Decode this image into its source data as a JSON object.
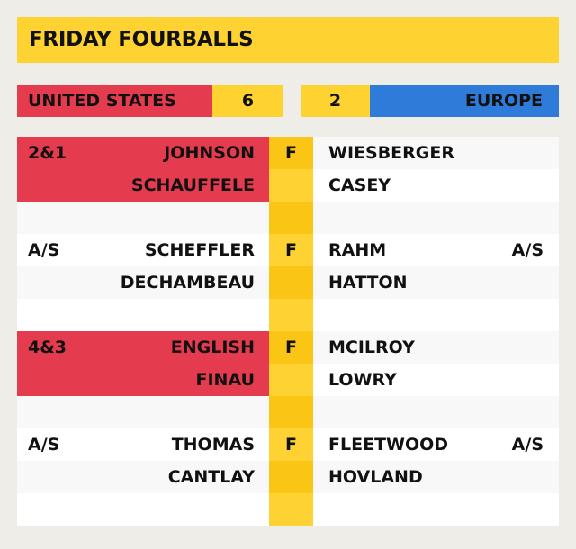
{
  "title": "FRIDAY FOURBALLS",
  "scoreboard": {
    "team_left": "UNITED STATES",
    "score_left": "6",
    "score_right": "2",
    "team_right": "EUROPE",
    "colors": {
      "usa": "#e43c4e",
      "europe": "#2e7bd9",
      "highlight": "#fed230"
    }
  },
  "matches": [
    {
      "status": "F",
      "result_left": "2&1",
      "result_right": "",
      "winner": "left",
      "left_players": [
        "JOHNSON",
        "SCHAUFFELE"
      ],
      "right_players": [
        "WIESBERGER",
        "CASEY"
      ]
    },
    {
      "status": "F",
      "result_left": "A/S",
      "result_right": "A/S",
      "winner": "none",
      "left_players": [
        "SCHEFFLER",
        "DECHAMBEAU"
      ],
      "right_players": [
        "RAHM",
        "HATTON"
      ]
    },
    {
      "status": "F",
      "result_left": "4&3",
      "result_right": "",
      "winner": "left",
      "left_players": [
        "ENGLISH",
        "FINAU"
      ],
      "right_players": [
        "MCILROY",
        "LOWRY"
      ]
    },
    {
      "status": "F",
      "result_left": "A/S",
      "result_right": "A/S",
      "winner": "none",
      "left_players": [
        "THOMAS",
        "CANTLAY"
      ],
      "right_players": [
        "FLEETWOOD",
        "HOVLAND"
      ]
    }
  ]
}
